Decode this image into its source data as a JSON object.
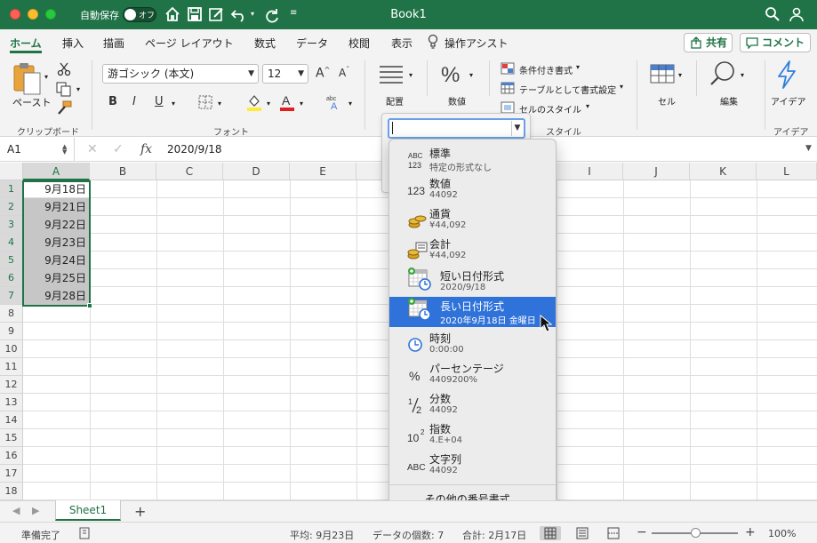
{
  "titlebar": {
    "autosave_label": "自動保存",
    "autosave_state": "オフ",
    "document_title": "Book1"
  },
  "ribbon_tabs": [
    "ホーム",
    "挿入",
    "描画",
    "ページ レイアウト",
    "数式",
    "データ",
    "校閲",
    "表示",
    "操作アシスト"
  ],
  "active_tab": "ホーム",
  "share_label": "共有",
  "comment_label": "コメント",
  "ribbon": {
    "clipboard": {
      "paste_label": "ペースト",
      "group_label": "クリップボード"
    },
    "font": {
      "font_name": "游ゴシック (本文)",
      "font_size": "12",
      "bold": "B",
      "italic": "I",
      "underline": "U",
      "group_label": "フォント"
    },
    "alignment": {
      "label": "配置"
    },
    "number": {
      "label": "数値"
    },
    "styles": {
      "conditional": "条件付き書式",
      "table": "テーブルとして書式設定",
      "cell_styles": "セルのスタイル",
      "group_label": "スタイル"
    },
    "cells": {
      "label": "セル"
    },
    "editing": {
      "label": "編集"
    },
    "ideas": {
      "label": "アイデア",
      "group_label": "アイデア"
    }
  },
  "formula_bar": {
    "name_box": "A1",
    "fx": "fx",
    "value": "2020/9/18"
  },
  "columns": [
    "A",
    "B",
    "C",
    "D",
    "E",
    "F",
    "G",
    "H",
    "I",
    "J",
    "K",
    "L"
  ],
  "rows": [
    "1",
    "2",
    "3",
    "4",
    "5",
    "6",
    "7",
    "8",
    "9",
    "10",
    "11",
    "12",
    "13",
    "14",
    "15",
    "16",
    "17",
    "18"
  ],
  "cells_a": [
    "9月18日",
    "9月21日",
    "9月22日",
    "9月23日",
    "9月24日",
    "9月25日",
    "9月28日"
  ],
  "number_format_menu": {
    "items": [
      {
        "title": "標準",
        "subtitle": "特定の形式なし",
        "icon": "abc-123-icon"
      },
      {
        "title": "数値",
        "subtitle": "44092",
        "icon": "number-123-icon"
      },
      {
        "title": "通貨",
        "subtitle": "¥44,092",
        "icon": "currency-coins-icon"
      },
      {
        "title": "会計",
        "subtitle": "¥44,092",
        "icon": "accounting-icon"
      },
      {
        "title": "短い日付形式",
        "subtitle": "2020/9/18",
        "icon": "calendar-clock-icon"
      },
      {
        "title": "長い日付形式",
        "subtitle": "2020年9月18日 金曜日",
        "icon": "calendar-clock-icon"
      },
      {
        "title": "時刻",
        "subtitle": "0:00:00",
        "icon": "clock-icon"
      },
      {
        "title": "パーセンテージ",
        "subtitle": "4409200%",
        "icon": "percent-icon"
      },
      {
        "title": "分数",
        "subtitle": "44092",
        "icon": "fraction-icon"
      },
      {
        "title": "指数",
        "subtitle": "4.E+04",
        "icon": "exponent-icon"
      },
      {
        "title": "文字列",
        "subtitle": "44092",
        "icon": "abc-text-icon"
      }
    ],
    "selected_index": 5,
    "more_label": "その他の番号書式..."
  },
  "sheet_tab": "Sheet1",
  "status": {
    "ready": "準備完了",
    "average": "平均: 9月23日",
    "count": "データの個数: 7",
    "sum": "合計: 2月17日",
    "zoom": "100%"
  },
  "colors": {
    "excel_green": "#1f7346",
    "selection_blue": "#2f72d9",
    "selected_cell_fill": "#c6c6c6"
  }
}
